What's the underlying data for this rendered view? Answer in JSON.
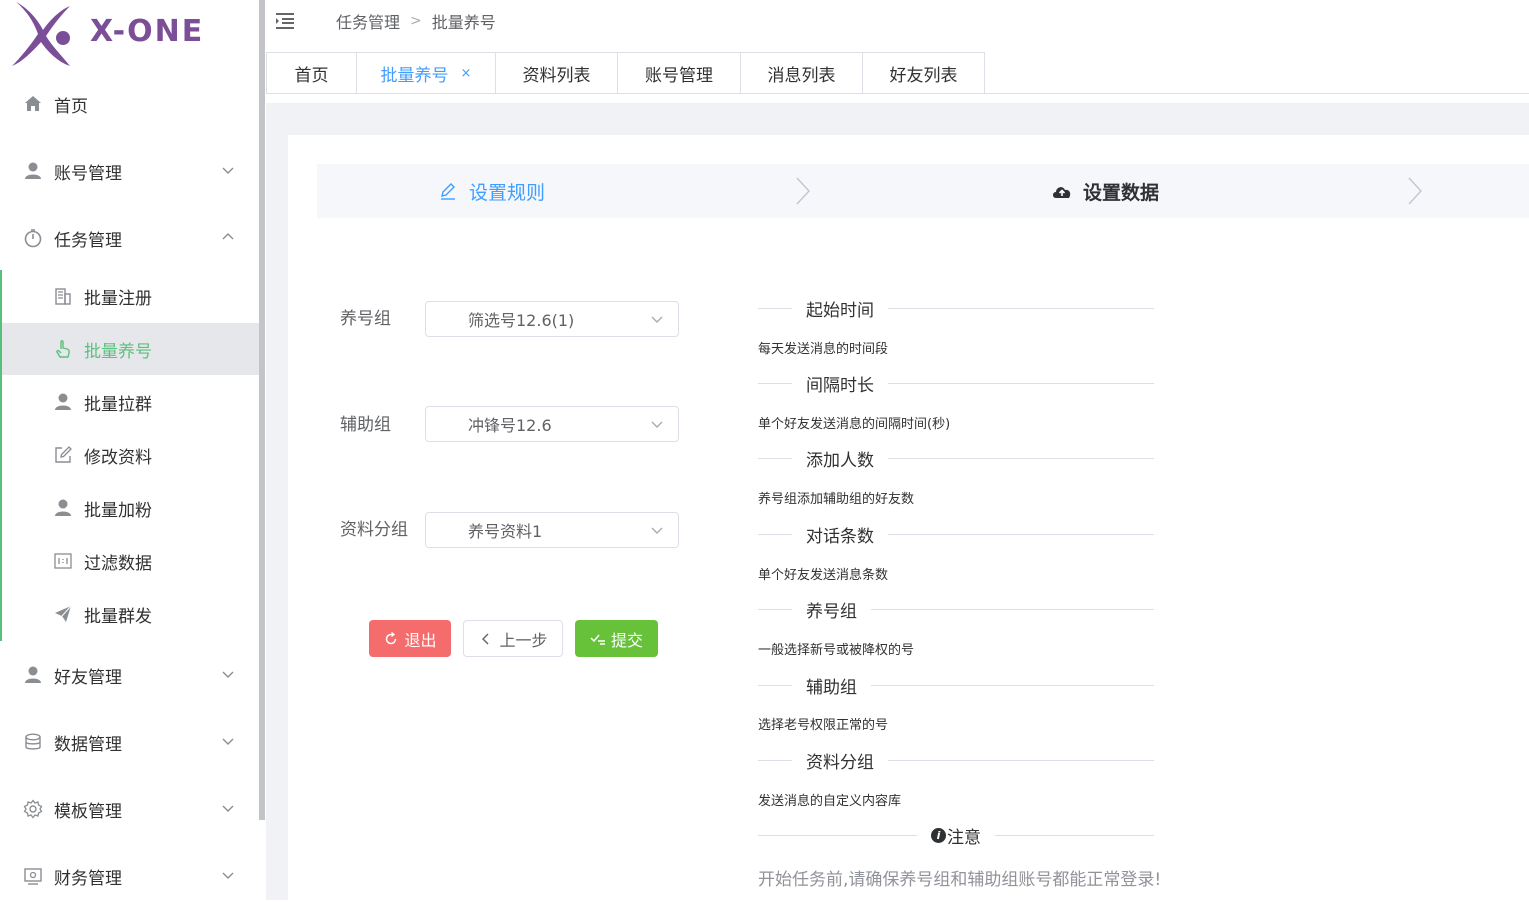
{
  "brand": {
    "logo_text": "X-ONE",
    "accent": "#7b4e98"
  },
  "colors": {
    "primary": "#409eff",
    "success": "#67c23a",
    "danger": "#f56c6c",
    "menu_active": "#5cc17c"
  },
  "sidebar": {
    "items": [
      {
        "label": "首页",
        "icon": "home-icon"
      },
      {
        "label": "账号管理",
        "icon": "user-icon",
        "expanded": false
      },
      {
        "label": "任务管理",
        "icon": "timer-icon",
        "expanded": true
      },
      {
        "label": "好友管理",
        "icon": "user-icon",
        "expanded": false
      },
      {
        "label": "数据管理",
        "icon": "database-icon",
        "expanded": false
      },
      {
        "label": "模板管理",
        "icon": "gear-icon",
        "expanded": false
      },
      {
        "label": "财务管理",
        "icon": "wallet-icon",
        "expanded": false
      }
    ],
    "task_submenu": [
      {
        "label": "批量注册",
        "icon": "office-building-icon"
      },
      {
        "label": "批量养号",
        "icon": "pointer-hand-icon",
        "active": true
      },
      {
        "label": "批量拉群",
        "icon": "user-icon"
      },
      {
        "label": "修改资料",
        "icon": "edit-icon"
      },
      {
        "label": "批量加粉",
        "icon": "user-icon"
      },
      {
        "label": "过滤数据",
        "icon": "filter-box-icon"
      },
      {
        "label": "批量群发",
        "icon": "send-icon"
      }
    ]
  },
  "header": {
    "breadcrumb": [
      "任务管理",
      "批量养号"
    ]
  },
  "tabs": [
    {
      "label": "首页",
      "active": false
    },
    {
      "label": "批量养号",
      "active": true,
      "closable": true,
      "close": "×"
    },
    {
      "label": "资料列表",
      "active": false
    },
    {
      "label": "账号管理",
      "active": false
    },
    {
      "label": "消息列表",
      "active": false
    },
    {
      "label": "好友列表",
      "active": false
    }
  ],
  "steps": [
    {
      "label": "设置规则",
      "icon": "edit-pen-icon",
      "state": "done"
    },
    {
      "label": "设置数据",
      "icon": "cloud-upload-icon",
      "state": "current"
    }
  ],
  "form": {
    "fields": [
      {
        "label": "养号组",
        "value": "筛选号12.6(1)"
      },
      {
        "label": "辅助组",
        "value": "冲锋号12.6"
      },
      {
        "label": "资料分组",
        "value": "养号资料1"
      }
    ],
    "buttons": {
      "exit": "退出",
      "prev": "上一步",
      "submit": "提交"
    }
  },
  "info": {
    "sections": [
      {
        "title": "起始时间",
        "desc": "每天发送消息的时间段"
      },
      {
        "title": "间隔时长",
        "desc": "单个好友发送消息的间隔时间(秒)"
      },
      {
        "title": "添加人数",
        "desc": "养号组添加辅助组的好友数"
      },
      {
        "title": "对话条数",
        "desc": "单个好友发送消息条数"
      },
      {
        "title": "养号组",
        "desc": "一般选择新号或被降权的号"
      },
      {
        "title": "辅助组",
        "desc": "选择老号权限正常的号"
      },
      {
        "title": "资料分组",
        "desc": "发送消息的自定义内容库"
      }
    ],
    "notice_title": "注意",
    "notice_icon": "i",
    "notice_text": "开始任务前,请确保养号组和辅助组账号都能正常登录!"
  }
}
